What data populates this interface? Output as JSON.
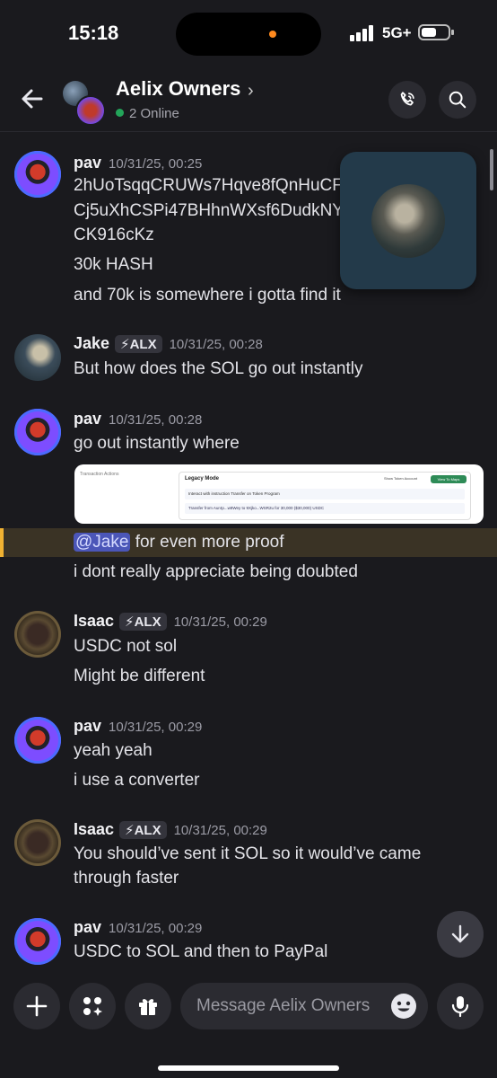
{
  "status": {
    "time": "15:18",
    "network": "5G+"
  },
  "header": {
    "title": "Aelix Owners",
    "chevron": "›",
    "online": "2 Online"
  },
  "messages": [
    {
      "user": "pav",
      "tag": "",
      "time": "10/31/25, 00:25",
      "lines": [
        "2hUoTsqqCRUWs7Hqve8fQnHuCF",
        "Cj5uXhCSPi47BHhnWXsf6DudkNY",
        "CK916cKz",
        "30k HASH",
        "and 70k is somewhere i gotta find it"
      ]
    },
    {
      "user": "Jake",
      "tag": "⚡ALX",
      "time": "10/31/25, 00:28",
      "lines": [
        "But how does the SOL go out instantly"
      ]
    },
    {
      "user": "pav",
      "tag": "",
      "time": "10/31/25, 00:28",
      "lines": [
        "go out instantly where",
        "for even more proof",
        "i dont really appreciate being doubted"
      ],
      "mention": "@Jake"
    },
    {
      "user": "Isaac",
      "tag": "⚡ALX",
      "time": "10/31/25, 00:29",
      "lines": [
        "USDC not sol",
        "Might be different"
      ]
    },
    {
      "user": "pav",
      "tag": "",
      "time": "10/31/25, 00:29",
      "lines": [
        "yeah yeah",
        "i use a converter"
      ]
    },
    {
      "user": "Isaac",
      "tag": "⚡ALX",
      "time": "10/31/25, 00:29",
      "lines": [
        "You should’ve sent it SOL so it would’ve came",
        "through faster"
      ]
    },
    {
      "user": "pav",
      "tag": "",
      "time": "10/31/25, 00:29",
      "lines": [
        "USDC to SOL and then to PayPal"
      ]
    }
  ],
  "attachment": {
    "section": "Transaction Actions",
    "mode": "Legacy Mode",
    "toggle_label": "Show Token Account",
    "view_button": "View To Maps",
    "row1": "Interact with instruction  Transfer  on  Token Program",
    "row2": "Transfer from Aur4p...w8Wey to 9Xjko...WSR2u for 30,000 ($30,000) USDC"
  },
  "composer": {
    "placeholder": "Message Aelix Owners"
  }
}
